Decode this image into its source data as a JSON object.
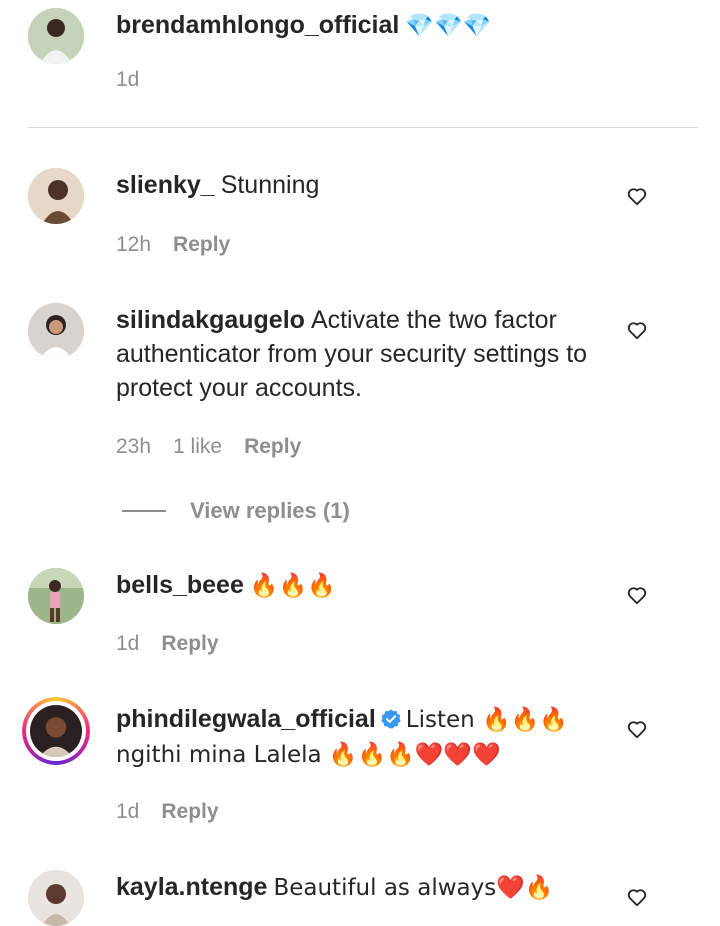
{
  "caption": {
    "username": "brendamhlongo_official",
    "emoji": "💎💎💎",
    "time": "1d"
  },
  "comments": [
    {
      "username": "slienky_",
      "text": "Stunning",
      "time": "12h",
      "likes": "",
      "reply_label": "Reply"
    },
    {
      "username": "silindakgaugelo",
      "text": "Activate the two factor authenticator from your security settings to protect your accounts.",
      "time": "23h",
      "likes": "1 like",
      "reply_label": "Reply",
      "view_replies": "View replies (1)"
    },
    {
      "username": "bells_beee",
      "text": "🔥🔥🔥",
      "time": "1d",
      "likes": "",
      "reply_label": "Reply"
    },
    {
      "username": "phindilegwala_official",
      "verified": true,
      "text_line1": "Listen 🔥🔥🔥",
      "text_line2": "ngithi mina Lalela 🔥🔥🔥❤️❤️❤️",
      "time": "1d",
      "likes": "",
      "reply_label": "Reply"
    },
    {
      "username": "kayla.ntenge",
      "text": "Beautiful as always❤️🔥",
      "time": "",
      "likes": "",
      "reply_label": ""
    }
  ],
  "icons": {
    "like": "heart-outline-icon",
    "verified": "verified-badge-icon"
  },
  "colors": {
    "text": "#262626",
    "muted": "#8e8e8e",
    "verified": "#3897f0",
    "divider": "#dbdbdb"
  }
}
